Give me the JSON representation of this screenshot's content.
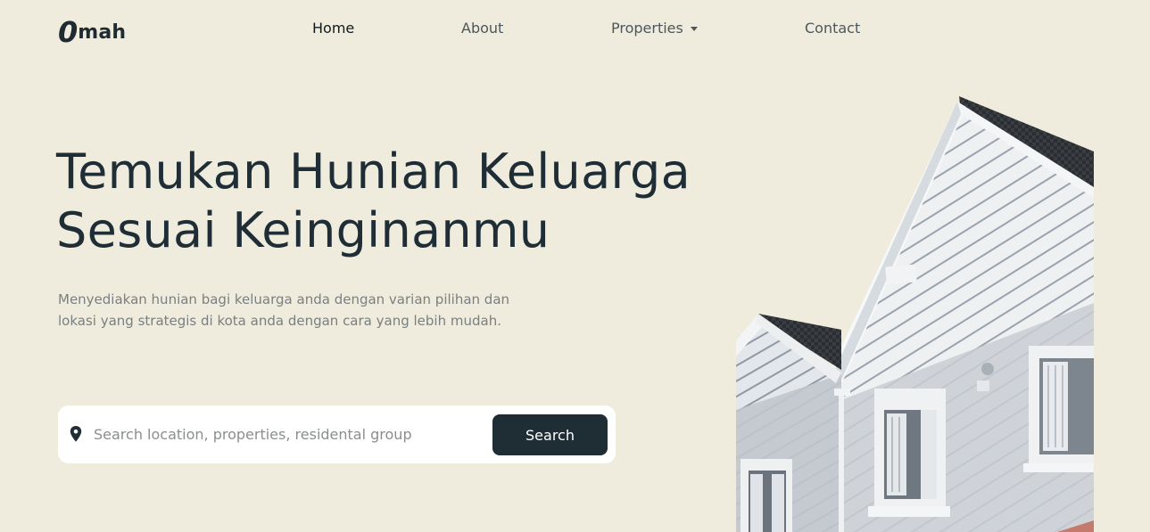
{
  "nav": {
    "logo_mark": "0",
    "logo_word": "mah",
    "links": [
      {
        "label": "Home"
      },
      {
        "label": "About"
      },
      {
        "label": "Properties"
      },
      {
        "label": "Contact"
      }
    ]
  },
  "hero": {
    "title_lines": [
      "Temukan Hunian Keluarga",
      "Sesuai Keinginanmu"
    ],
    "description_lines": [
      "Menyediakan hunian bagi keluarga anda dengan varian pilihan dan",
      "lokasi yang strategis di kota anda dengan cara yang lebih mudah."
    ]
  },
  "search": {
    "placeholder": "Search location, properties, residental group",
    "value": "",
    "button_label": "Search",
    "icon": "location-pin-icon"
  },
  "colors": {
    "background": "#efecdd",
    "primary_dark": "#1f2d35",
    "text_muted": "#7a7f80"
  }
}
